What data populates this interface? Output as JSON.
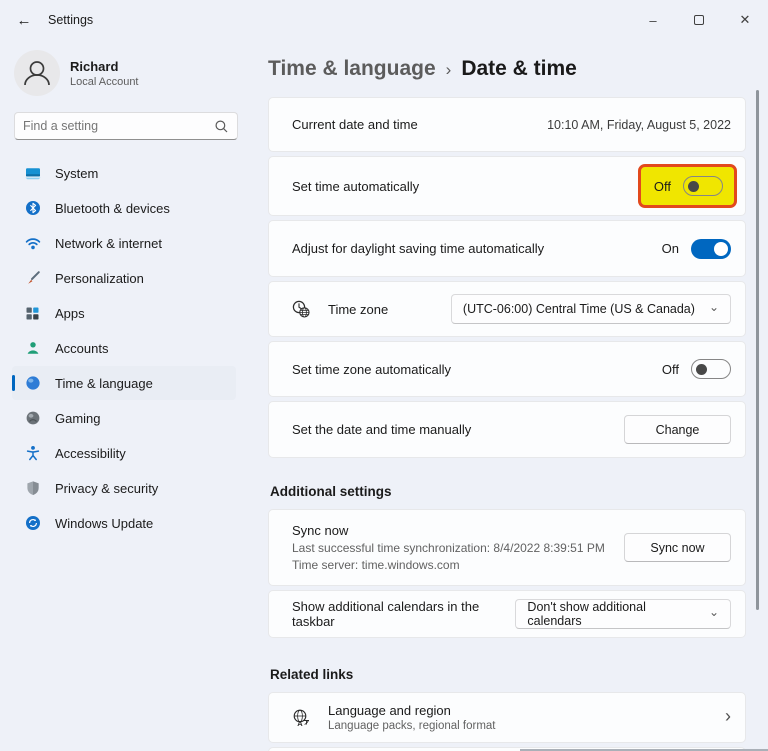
{
  "window": {
    "title": "Settings",
    "minimize_glyph": "–",
    "close_glyph": "✕"
  },
  "icons": {
    "back_arrow": "←",
    "chevron_down": "⌄",
    "chevron_right": "›",
    "breadcrumb_separator": "›"
  },
  "sidebar": {
    "profile": {
      "name": "Richard",
      "subtitle": "Local Account"
    },
    "search": {
      "placeholder": "Find a setting"
    },
    "items": [
      {
        "label": "System"
      },
      {
        "label": "Bluetooth & devices"
      },
      {
        "label": "Network & internet"
      },
      {
        "label": "Personalization"
      },
      {
        "label": "Apps"
      },
      {
        "label": "Accounts"
      },
      {
        "label": "Time & language",
        "selected": true
      },
      {
        "label": "Gaming"
      },
      {
        "label": "Accessibility"
      },
      {
        "label": "Privacy & security"
      },
      {
        "label": "Windows Update"
      }
    ]
  },
  "header": {
    "breadcrumb_parent": "Time & language",
    "page_title": "Date & time"
  },
  "main": {
    "cards": {
      "current_datetime": {
        "label": "Current date and time",
        "value": "10:10 AM, Friday, August 5, 2022"
      },
      "set_time_auto": {
        "label": "Set time automatically",
        "state": "Off"
      },
      "daylight_saving": {
        "label": "Adjust for daylight saving time automatically",
        "state": "On"
      },
      "time_zone": {
        "label": "Time zone",
        "value": "(UTC-06:00) Central Time (US & Canada)"
      },
      "set_timezone_auto": {
        "label": "Set time zone automatically",
        "state": "Off"
      },
      "set_manual": {
        "label": "Set the date and time manually",
        "button": "Change"
      },
      "sync": {
        "title": "Sync now",
        "line1": "Last successful time synchronization: 8/4/2022 8:39:51 PM",
        "line2": "Time server: time.windows.com",
        "button": "Sync now"
      },
      "calendars": {
        "label": "Show additional calendars in the taskbar",
        "value": "Don't show additional calendars"
      }
    },
    "sections": {
      "additional": "Additional settings",
      "related": "Related links"
    },
    "related_links": {
      "language_region": {
        "title": "Language and region",
        "subtitle": "Language packs, regional format"
      }
    }
  },
  "colors": {
    "accent": "#0067c0",
    "highlight_fill": "#f0e600",
    "highlight_border": "#e2491d"
  }
}
